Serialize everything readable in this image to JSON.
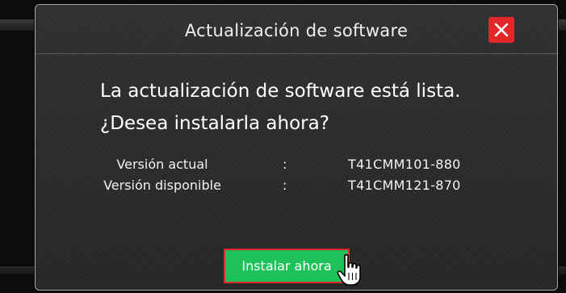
{
  "dialog": {
    "title": "Actualización de software",
    "close_icon": "close-icon",
    "message_line1": "La actualización de software está lista.",
    "message_line2": "¿Desea instalarla ahora?",
    "info": [
      {
        "label": "Versión actual",
        "separator": ":",
        "value": "T41CMM101-880"
      },
      {
        "label": "Versión disponible",
        "separator": ":",
        "value": "T41CMM121-870"
      }
    ],
    "install_label": "Instalar ahora",
    "pointer_icon": "hand-pointer-icon"
  },
  "colors": {
    "accent_red": "#e3262a",
    "button_green": "#1ec25a",
    "dialog_bg": "#2b2b2b"
  }
}
